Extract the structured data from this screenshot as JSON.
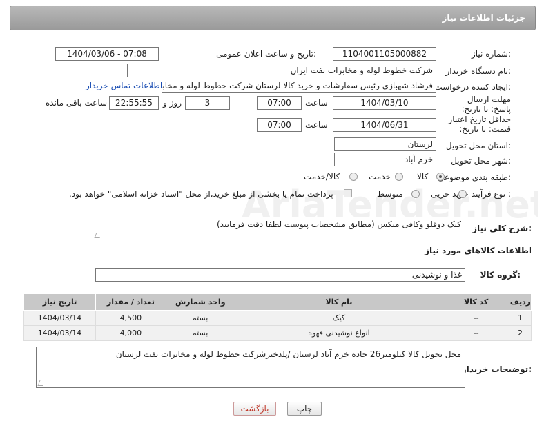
{
  "header": {
    "title": "جزئیات اطلاعات نیاز"
  },
  "fields": {
    "need_number_label": "شماره نیاز:",
    "need_number": "1104001105000882",
    "announce_label": "تاریخ و ساعت اعلان عمومی:",
    "announce_value": "1404/03/06 - 07:08",
    "buyer_org_label": "نام دستگاه خریدار:",
    "buyer_org": "شرکت خطوط لوله و مخابرات نفت ایران",
    "creator_label": "ایجاد کننده درخواست:",
    "creator": "فرشاد شهبازی رئیس سفارشات و خرید کالا لرستان شرکت خطوط لوله و مخابرات نفت ایران",
    "contact_link": "اطلاعات تماس خریدار",
    "reply_deadline_label": "مهلت ارسال پاسخ: تا تاریخ:",
    "reply_date": "1404/03/10",
    "time_label": "ساعت",
    "reply_time": "07:00",
    "days_value": "3",
    "days_label": "روز و",
    "remaining_time": "22:55:55",
    "remaining_label": "ساعت باقی مانده",
    "price_validity_label": "حداقل تاریخ اعتبار قیمت: تا تاریخ:",
    "price_date": "1404/06/31",
    "price_time": "07:00",
    "province_label": "استان محل تحویل:",
    "province": "لرستان",
    "city_label": "شهر محل تحویل:",
    "city": "خرم آباد",
    "category_label": "طبقه بندی موضوعی:",
    "category_options": [
      "کالا",
      "خدمت",
      "کالا/خدمت"
    ],
    "process_label": "نوع فرآیند خرید :",
    "process_options": [
      "جزیی",
      "متوسط"
    ],
    "payment_note": "پرداخت تمام یا بخشی از مبلغ خرید،از محل \"اسناد خزانه اسلامی\" خواهد بود."
  },
  "description": {
    "label": "شرح کلی نیاز:",
    "text": "کیک دوقلو وکافی میکس (مطابق مشخصات پیوست لطفا دقت فرمایید)"
  },
  "goods": {
    "section_title": "اطلاعات کالاهای مورد نیاز",
    "group_label": "گروه کالا:",
    "group_value": "غذا و نوشیدنی"
  },
  "table": {
    "headers": [
      "ردیف",
      "کد کالا",
      "نام کالا",
      "واحد شمارش",
      "تعداد / مقدار",
      "تاریخ نیاز"
    ],
    "rows": [
      [
        "1",
        "--",
        "کیک",
        "بسته",
        "4,500",
        "1404/03/14"
      ],
      [
        "2",
        "--",
        "انواع نوشیدنی قهوه",
        "بسته",
        "4,000",
        "1404/03/14"
      ]
    ]
  },
  "buyer_notes": {
    "label": "توضیحات خریدار:",
    "text": "محل تحویل کالا کیلومتر26 جاده خرم آباد لرستان /پلدخترشرکت خطوط لوله و مخابرات نفت لرستان"
  },
  "buttons": {
    "print": "چاپ",
    "back": "بازگشت"
  },
  "watermark": {
    "text": "AriaTender.net"
  },
  "colors": {
    "header_bg": "#a8a8a8",
    "link": "#1a4db3",
    "back_text": "#c0392b"
  }
}
